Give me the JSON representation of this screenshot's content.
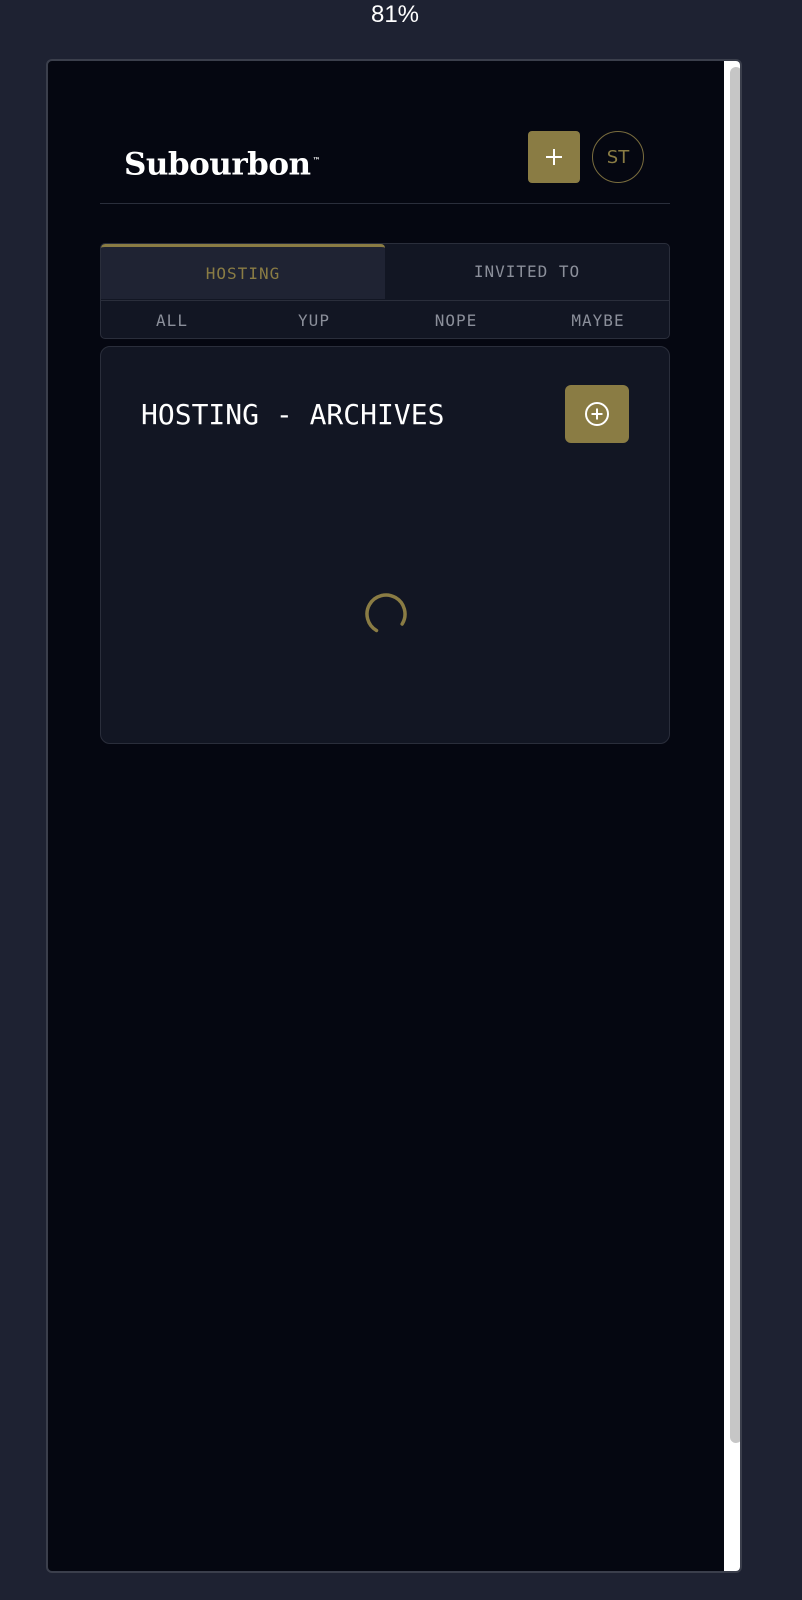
{
  "zoom_level": "81%",
  "header": {
    "brand_name": "Subourbon",
    "brand_mark": "™",
    "add_icon": "plus-icon",
    "avatar_initials": "ST"
  },
  "tabs": [
    {
      "label": "HOSTING",
      "active": true
    },
    {
      "label": "INVITED TO",
      "active": false
    }
  ],
  "subtabs": [
    {
      "label": "ALL"
    },
    {
      "label": "YUP"
    },
    {
      "label": "NOPE"
    },
    {
      "label": "MAYBE"
    }
  ],
  "card": {
    "title": "HOSTING - ARCHIVES",
    "add_icon": "circle-plus-icon",
    "loading": true
  },
  "colors": {
    "accent": "#8a7c44",
    "background": "#050711",
    "panel": "#121623",
    "active_tab": "#1f2333",
    "muted_text": "#8b8f9a"
  }
}
